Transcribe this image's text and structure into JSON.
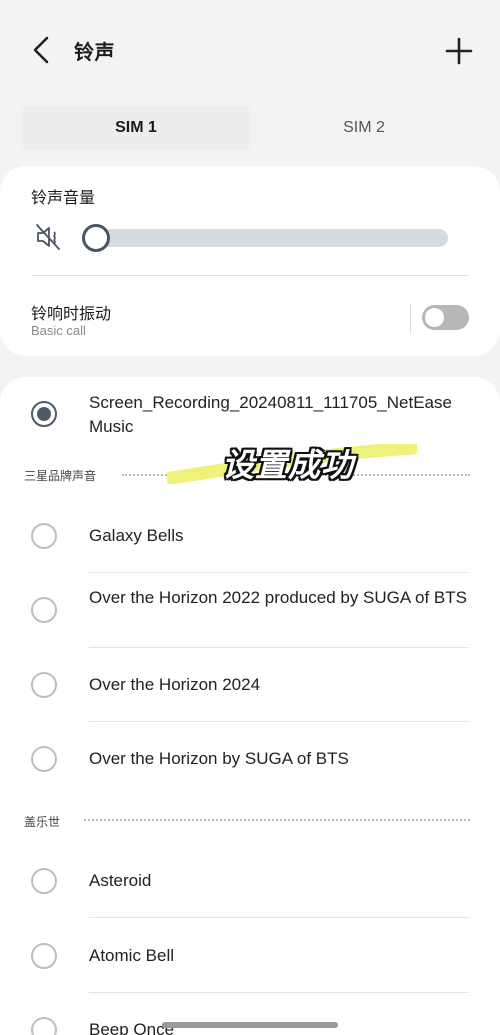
{
  "header": {
    "title": "铃声"
  },
  "tabs": [
    {
      "label": "SIM 1",
      "active": true
    },
    {
      "label": "SIM 2",
      "active": false
    }
  ],
  "volume": {
    "label": "铃声音量",
    "level": 0
  },
  "vibrate": {
    "label": "铃响时振动",
    "sublabel": "Basic call",
    "on": false
  },
  "selected_item": "Screen_Recording_20240811_111705_NetEase Music",
  "sections": [
    {
      "title": "三星品牌声音"
    },
    {
      "title": "盖乐世"
    }
  ],
  "items": [
    "Galaxy Bells",
    "Over the Horizon 2022 produced by SUGA of BTS",
    "Over the Horizon 2024",
    "Over the Horizon by SUGA of BTS",
    "Asteroid",
    "Atomic Bell",
    "Beep Once"
  ],
  "overlay": {
    "text": "设置成功"
  },
  "colors": {
    "accent": "#4e5a68",
    "track": "#d6dbe3",
    "highlight": "#eef27a"
  },
  "icons": {
    "back": "chevron-left-icon",
    "add": "plus-icon",
    "mute": "volume-mute-icon"
  }
}
